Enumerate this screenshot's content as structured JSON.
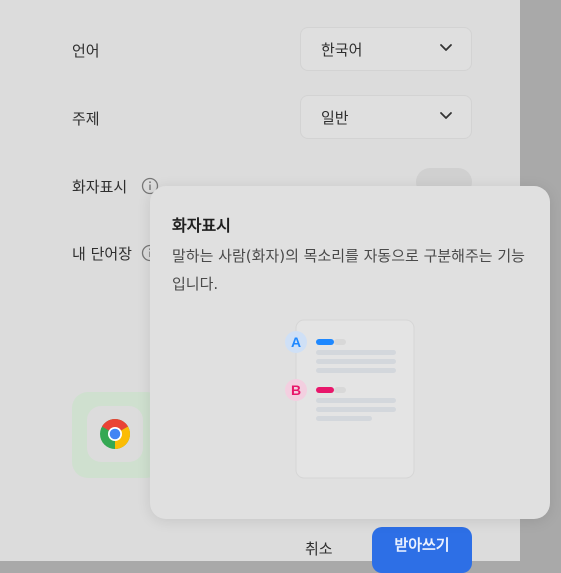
{
  "settings": {
    "language": {
      "label": "언어",
      "value": "한국어"
    },
    "topic": {
      "label": "주제",
      "value": "일반"
    },
    "speaker_display": {
      "label": "화자표시"
    },
    "my_words": {
      "label": "내 단어장"
    }
  },
  "popover": {
    "title": "화자표시",
    "description": "말하는 사람(화자)의 목소리를 자동으로 구분해주는 기능입니다.",
    "speaker_a": "A",
    "speaker_b": "B"
  },
  "actions": {
    "cancel": "취소",
    "primary": "받아쓰기"
  },
  "colors": {
    "accent": "#2d6fe6",
    "speaker_a": "#1e88ff",
    "speaker_b": "#e8176b"
  }
}
